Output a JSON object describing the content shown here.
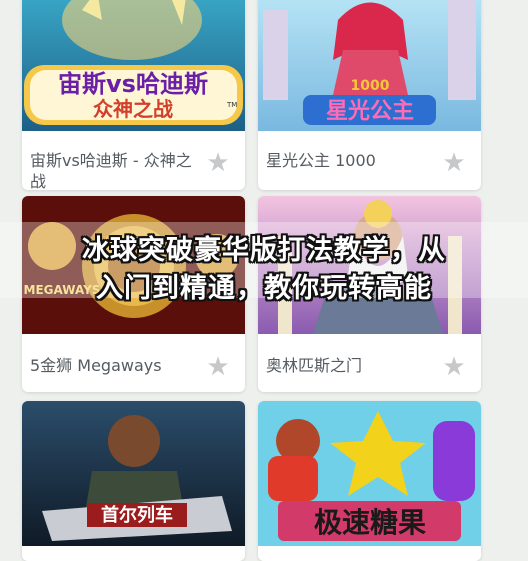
{
  "overlay": {
    "headline_line1": "冰球突破豪华版打法教学，从",
    "headline_line2": "入门到精通，教你玩转高能"
  },
  "games": [
    {
      "caption": "宙斯vs哈迪斯 - 众神之战",
      "caption_suffix": "™",
      "art_title_line1": "宙斯vs哈迪斯",
      "art_title_line2": "众神之战",
      "art_tm": "TM",
      "favorite_icon": "star-icon"
    },
    {
      "caption": "星光公主 1000",
      "art_title": "星光公主",
      "art_badge": "1000",
      "favorite_icon": "star-icon"
    },
    {
      "caption": "5金狮 Megaways",
      "art_title": "MEGAWAYS",
      "favorite_icon": "star-icon"
    },
    {
      "caption": "奥林匹斯之门",
      "favorite_icon": "star-icon"
    },
    {
      "caption": "",
      "art_title": "首尔列车",
      "favorite_icon": "star-icon"
    },
    {
      "caption": "",
      "art_title": "极速糖果",
      "favorite_icon": "star-icon"
    }
  ],
  "colors": {
    "background": "#eef0ee",
    "card": "#ffffff",
    "caption_text": "#555b60",
    "star_inactive": "#c6c8ca"
  }
}
